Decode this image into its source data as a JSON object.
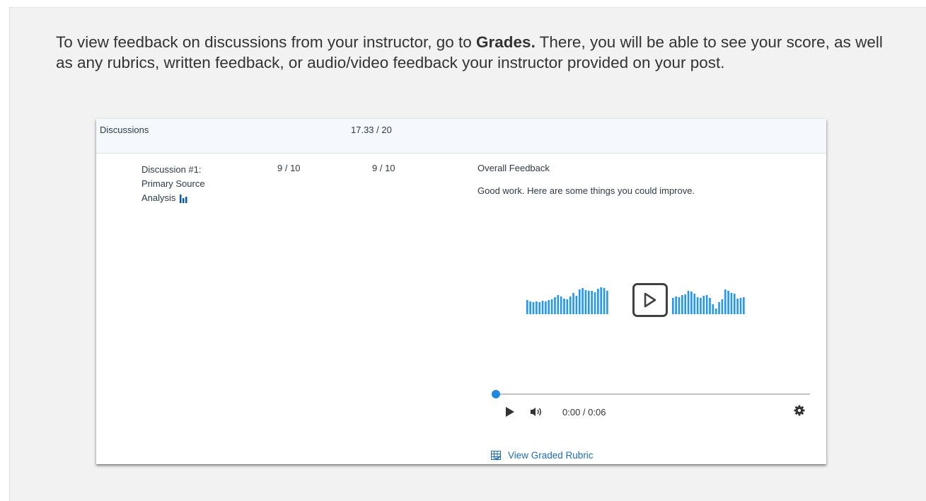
{
  "intro": {
    "text_before": "To view feedback on discussions from your instructor, go to ",
    "bold": "Grades.",
    "text_after": " There, you will be able to see your score, as well as any rubrics, written feedback, or audio/video feedback your instructor provided on your post."
  },
  "category": {
    "name": "Discussions",
    "score": "17.33 / 20"
  },
  "item": {
    "name_lines": [
      "Discussion #1:",
      "Primary Source",
      "Analysis"
    ],
    "score": "9 / 10",
    "out_of": "9 / 10",
    "stats_icon": "bar-chart-icon"
  },
  "feedback": {
    "title": "Overall Feedback",
    "text": "Good work. Here are some things you could improve."
  },
  "player": {
    "time": "0:00 / 0:06",
    "progress": 0,
    "waveform_color": "#2196f3",
    "play_icon": "play-outline-icon",
    "gear_icon": "gear-icon"
  },
  "rubric": {
    "link_label": "View Graded Rubric",
    "icon": "rubric-icon"
  },
  "colors": {
    "link": "#1c6db4",
    "category_bg": "#f5f8fc",
    "panel_bg": "#f2f2f2"
  }
}
